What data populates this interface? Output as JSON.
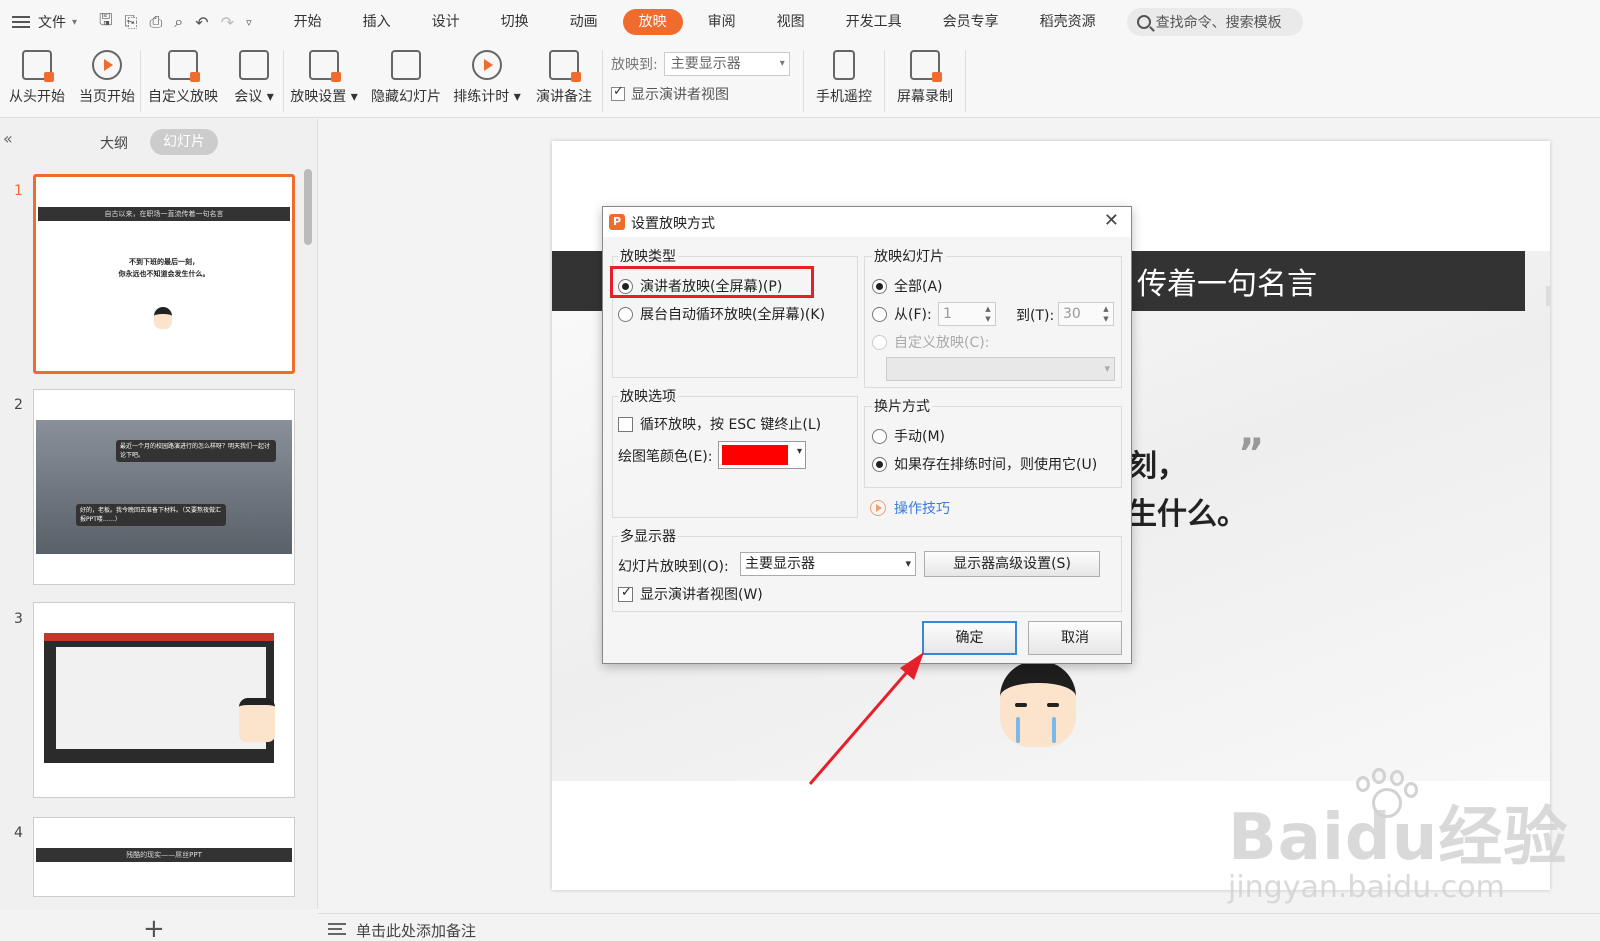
{
  "menubar": {
    "file_label": "文件",
    "tabs": [
      "开始",
      "插入",
      "设计",
      "切换",
      "动画",
      "放映",
      "审阅",
      "视图",
      "开发工具",
      "会员专享",
      "稻壳资源"
    ],
    "active_tab": "放映",
    "search_placeholder": "查找命令、搜索模板"
  },
  "ribbon": {
    "from_start": "从头开始",
    "from_current": "当页开始",
    "custom_show": "自定义放映",
    "meeting": "会议",
    "show_settings": "放映设置",
    "hide_slide": "隐藏幻灯片",
    "rehearse": "排练计时",
    "speaker_notes": "演讲备注",
    "project_to_label": "放映到:",
    "project_to_value": "主要显示器",
    "show_presenter_view": "显示演讲者视图",
    "phone_remote": "手机遥控",
    "screen_record": "屏幕录制"
  },
  "left_panel": {
    "tab_outline": "大纲",
    "tab_slides": "幻灯片",
    "slides": [
      {
        "num": "1",
        "bar": "自古以来，在职场一直流传着一句名言",
        "line1": "不到下班的最后一刻，",
        "line2": "你永远也不知道会发生什么。"
      },
      {
        "num": "2",
        "bubble1": "最近一个月的校园路演进行的怎么样呀？明天我们一起讨论下吧。",
        "bubble2": "好的，老板。我今晚回去准备下材料。（又要熬夜做汇报PPT喽……）"
      },
      {
        "num": "3"
      },
      {
        "num": "4",
        "bar": "残酷的现实——屌丝PPT"
      }
    ],
    "add_symbol": "+"
  },
  "slide": {
    "title": "传着一句名言",
    "line1": "刻，",
    "line2": "生什么。",
    "quote": "”"
  },
  "notes": {
    "placeholder": "单击此处添加备注"
  },
  "watermark": {
    "brand": "Baidu经验",
    "url": "jingyan.baidu.com"
  },
  "dialog": {
    "title": "设置放映方式",
    "show_type": {
      "label": "放映类型",
      "presenter": "演讲者放映(全屏幕)(P)",
      "kiosk": "展台自动循环放映(全屏幕)(K)"
    },
    "show_slides": {
      "label": "放映幻灯片",
      "all": "全部(A)",
      "from": "从(F):",
      "from_value": "1",
      "to": "到(T):",
      "to_value": "30",
      "custom": "自定义放映(C):"
    },
    "show_options": {
      "label": "放映选项",
      "loop": "循环放映，按 ESC 键终止(L)",
      "pen_color": "绘图笔颜色(E):",
      "pen_color_value": "#ff0000"
    },
    "advance": {
      "label": "换片方式",
      "manual": "手动(M)",
      "timings": "如果存在排练时间，则使用它(U)"
    },
    "tips": "操作技巧",
    "multi_monitor": {
      "label": "多显示器",
      "show_on": "幻灯片放映到(O):",
      "show_on_value": "主要显示器",
      "advanced": "显示器高级设置(S)",
      "presenter_view": "显示演讲者视图(W)"
    },
    "ok": "确定",
    "cancel": "取消"
  },
  "colors": {
    "accent": "#f06b2e",
    "annotation_red": "#e5202a",
    "ok_border": "#3b87d6"
  }
}
